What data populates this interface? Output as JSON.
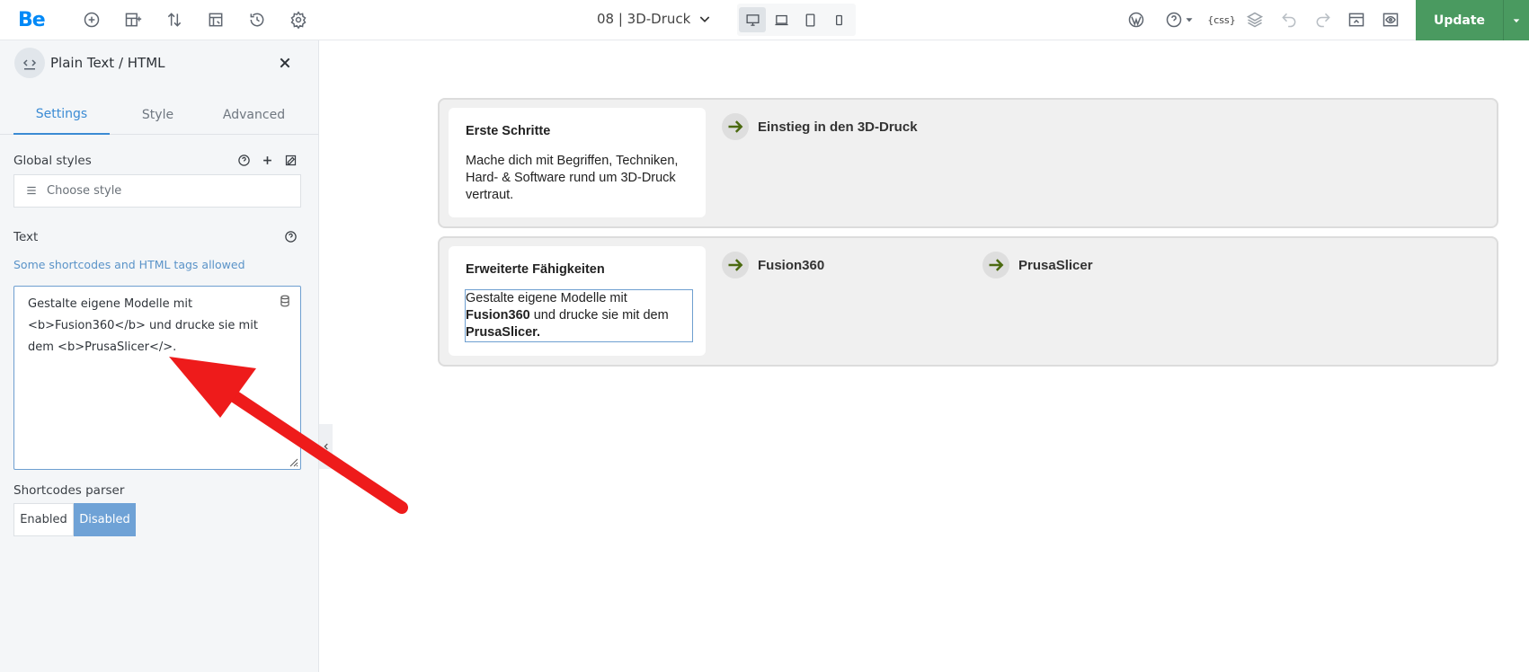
{
  "topbar": {
    "logo": "Be",
    "page_title": "08 | 3D-Druck",
    "update_label": "Update",
    "icons": [
      "add-circle-icon",
      "layout-icon",
      "sort-icon",
      "template-icon",
      "history-icon",
      "settings-icon",
      "wordpress-icon",
      "help-icon",
      "css-icon",
      "layers-icon",
      "undo-icon",
      "redo-icon",
      "preview-icon",
      "eye-icon"
    ],
    "devices": [
      "desktop",
      "laptop",
      "tablet",
      "mobile"
    ],
    "css_label": "{css}"
  },
  "sidebar": {
    "title": "Plain Text / HTML",
    "tabs": [
      {
        "label": "Settings",
        "active": true
      },
      {
        "label": "Style",
        "active": false
      },
      {
        "label": "Advanced",
        "active": false
      }
    ],
    "global_styles_label": "Global styles",
    "choose_style_placeholder": "Choose style",
    "text_label": "Text",
    "text_hint": "Some shortcodes and HTML tags allowed",
    "text_value": "Gestalte eigene Modelle mit\n<b>Fusion360</b> und drucke sie mit\ndem <b>PrusaSlicer</>.",
    "shortcodes_label": "Shortcodes parser",
    "shortcodes_options": [
      "Enabled",
      "Disabled"
    ],
    "shortcodes_selected": "Disabled"
  },
  "canvas": {
    "sections": [
      {
        "card_title": "Erste Schritte",
        "card_text": "Mache dich mit Begriffen, Techniken, Hard- & Software rund um 3D-Druck vertraut.",
        "links": [
          "Einstieg in den 3D-Druck"
        ]
      },
      {
        "card_title": "Erweiterte Fähigkeiten",
        "card_text_parts": [
          "Gestalte eigene Modelle mit ",
          "Fusion360",
          " und drucke sie mit dem ",
          "PrusaSlicer."
        ],
        "links": [
          "Fusion360",
          "PrusaSlicer"
        ]
      }
    ]
  },
  "colors": {
    "accent_blue": "#3b8bd4",
    "update_green": "#4a9a60",
    "annotation_red": "#ee1b1b",
    "link_arrow_green": "#4b6a10"
  }
}
